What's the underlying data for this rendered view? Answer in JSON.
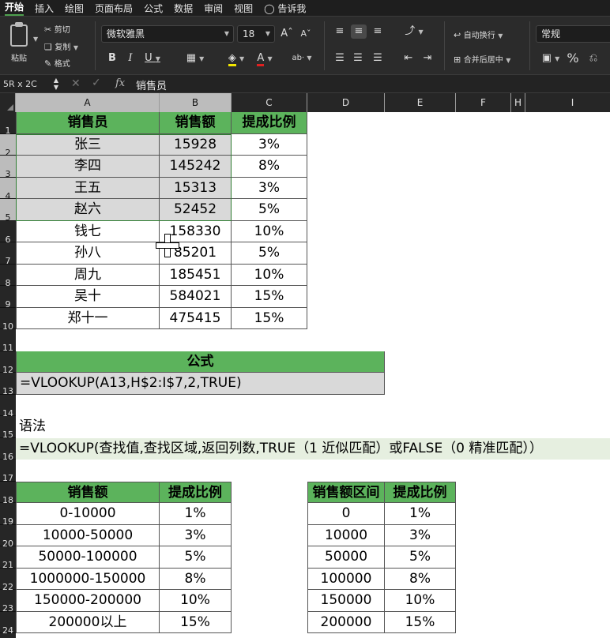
{
  "menu": [
    "开始",
    "插入",
    "绘图",
    "页面布局",
    "公式",
    "数据",
    "审阅",
    "视图",
    "告诉我"
  ],
  "ribbon": {
    "paste": "粘贴",
    "cut": "剪切",
    "copy": "复制",
    "format_painter": "格式",
    "font_name": "微软雅黑",
    "font_size": "18",
    "wrap_text": "自动换行",
    "merge_center": "合并后居中",
    "number_format": "常规",
    "percent": "%"
  },
  "formula_bar": {
    "name_box": "5R x 2C",
    "fx": "fx",
    "content": "销售员"
  },
  "columns": [
    "A",
    "B",
    "C",
    "D",
    "E",
    "F",
    "H",
    "I"
  ],
  "rows": [
    "1",
    "2",
    "3",
    "4",
    "5",
    "6",
    "7",
    "8",
    "9",
    "10",
    "11",
    "12",
    "13",
    "14",
    "15",
    "16",
    "17",
    "18",
    "19",
    "20",
    "21",
    "22",
    "23",
    "24"
  ],
  "table1": {
    "headers": [
      "销售员",
      "销售额",
      "提成比例"
    ],
    "rows": [
      [
        "张三",
        "15928",
        "3%"
      ],
      [
        "李四",
        "145242",
        "8%"
      ],
      [
        "王五",
        "15313",
        "3%"
      ],
      [
        "赵六",
        "52452",
        "5%"
      ],
      [
        "钱七",
        "158330",
        "10%"
      ],
      [
        "孙八",
        "85201",
        "5%"
      ],
      [
        "周九",
        "185451",
        "10%"
      ],
      [
        "吴十",
        "584021",
        "15%"
      ],
      [
        "郑十一",
        "475415",
        "15%"
      ]
    ]
  },
  "formula_section": {
    "title": "公式",
    "formula": "=VLOOKUP(A13,H$2:I$7,2,TRUE)"
  },
  "syntax": {
    "label": "语法",
    "text": "=VLOOKUP(查找值,查找区域,返回列数,TRUE（1 近似匹配）或FALSE（0 精准匹配））"
  },
  "table2": {
    "headers": [
      "销售额",
      "提成比例"
    ],
    "rows": [
      [
        "0-10000",
        "1%"
      ],
      [
        "10000-50000",
        "3%"
      ],
      [
        "50000-100000",
        "5%"
      ],
      [
        "1000000-150000",
        "8%"
      ],
      [
        "150000-200000",
        "10%"
      ],
      [
        "200000以上",
        "15%"
      ]
    ]
  },
  "table3": {
    "headers": [
      "销售额区间",
      "提成比例"
    ],
    "rows": [
      [
        "0",
        "1%"
      ],
      [
        "10000",
        "3%"
      ],
      [
        "50000",
        "5%"
      ],
      [
        "100000",
        "8%"
      ],
      [
        "150000",
        "10%"
      ],
      [
        "200000",
        "15%"
      ]
    ]
  },
  "colors": {
    "header_green": "#5cb35c",
    "selection_grey": "#d9d9d9",
    "ribbon_bg": "#2b2b2b"
  }
}
